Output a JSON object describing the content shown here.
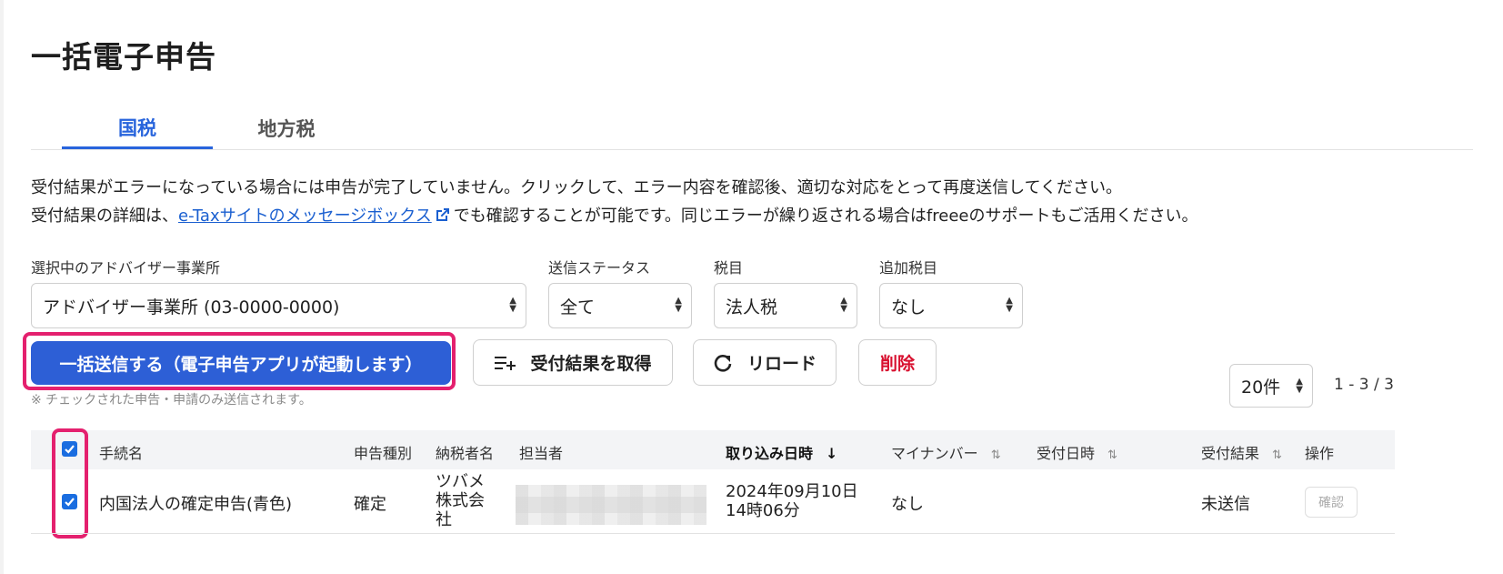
{
  "page": {
    "title": "一括電子申告"
  },
  "tabs": [
    {
      "label": "国税",
      "active": true
    },
    {
      "label": "地方税",
      "active": false
    }
  ],
  "info": {
    "line1": "受付結果がエラーになっている場合には申告が完了していません。クリックして、エラー内容を確認後、適切な対応をとって再度送信してください。",
    "line2_prefix": "受付結果の詳細は、",
    "line2_link": "e-Taxサイトのメッセージボックス",
    "line2_suffix": "でも確認することが可能です。同じエラーが繰り返される場合はfreeeのサポートもご活用ください。"
  },
  "filters": {
    "advisor": {
      "label": "選択中のアドバイザー事業所",
      "value": "アドバイザー事業所 (03-0000-0000)"
    },
    "status": {
      "label": "送信ステータス",
      "value": "全て"
    },
    "tax_item": {
      "label": "税目",
      "value": "法人税"
    },
    "extra_tax_item": {
      "label": "追加税目",
      "value": "なし"
    }
  },
  "actions": {
    "bulk_send": "一括送信する（電子申告アプリが起動します）",
    "fetch_results": "受付結果を取得",
    "reload": "リロード",
    "delete": "削除",
    "note": "※ チェックされた申告・申請のみ送信されます。"
  },
  "pagination": {
    "per_page": "20件",
    "range": "1 - 3 / 3"
  },
  "table": {
    "headers": {
      "procedure": "手続名",
      "filing_type": "申告種別",
      "taxpayer": "納税者名",
      "assignee": "担当者",
      "imported_at": "取り込み日時",
      "my_number": "マイナンバー",
      "received_at": "受付日時",
      "result": "受付結果",
      "operation": "操作"
    },
    "rows": [
      {
        "checked": true,
        "procedure": "内国法人の確定申告(青色)",
        "filing_type": "確定",
        "taxpayer": "ツバメ株式会社",
        "imported_at": "2024年09月10日14時06分",
        "my_number": "なし",
        "received_at": "",
        "result": "未送信",
        "operation": "確認"
      }
    ]
  },
  "colors": {
    "accent": "#2864dc",
    "primary_button": "#2d5fd6",
    "danger": "#d8102f",
    "highlight": "#e4206e"
  }
}
